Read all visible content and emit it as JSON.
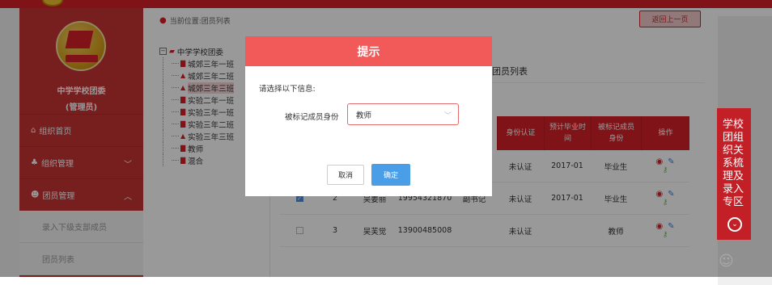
{
  "breadcrumb": "当前位置:团员列表",
  "back_button": "返回上一页",
  "sidebar": {
    "org_name": "中学学校团委",
    "org_role": "(管理员)",
    "menu": [
      {
        "label": "组织首页",
        "icon": "home-icon"
      },
      {
        "label": "组织管理",
        "icon": "org-icon",
        "chevron": "﹀"
      },
      {
        "label": "团员管理",
        "icon": "member-icon",
        "chevron": "︿"
      }
    ],
    "submenu": [
      "录入下级支部成员",
      "团员列表"
    ]
  },
  "tree": {
    "root": "中学学校团委",
    "items": [
      "城郊三年一班",
      "城郊三年二班",
      "城郊三年三班",
      "实验二年一班",
      "实验三年一班",
      "实验三年二班",
      "实验三年三班",
      "教师",
      "混合"
    ]
  },
  "table": {
    "title": "延迟毕业团员列表",
    "headers": [
      "身份认证",
      "预计毕业时间",
      "被标记成员身份",
      "操作"
    ],
    "rows": [
      {
        "checked": false,
        "no": "",
        "name": "",
        "phone": "",
        "position": "",
        "auth": "未认证",
        "grad": "2017-01",
        "identity": "毕业生"
      },
      {
        "checked": true,
        "no": "2",
        "name": "吴姜丽",
        "phone": "19954321870",
        "position": "副书记",
        "auth": "未认证",
        "grad": "2017-01",
        "identity": "毕业生"
      },
      {
        "checked": false,
        "no": "3",
        "name": "吴芙觉",
        "phone": "13900485008",
        "position": "",
        "auth": "未认证",
        "grad": "",
        "identity": "教师"
      }
    ]
  },
  "modal": {
    "title": "提示",
    "message": "请选择以下信息:",
    "field_label": "被标记成员身份",
    "select_value": "教师",
    "cancel": "取消",
    "confirm": "确定"
  },
  "float_panel": {
    "text": "学校团组织关系梳理及录入专区",
    "icon": "chevron-down-circle-icon"
  },
  "colors": {
    "brand": "#d42128",
    "modal_header": "#f25a5a",
    "primary_button": "#4a9ee8"
  }
}
